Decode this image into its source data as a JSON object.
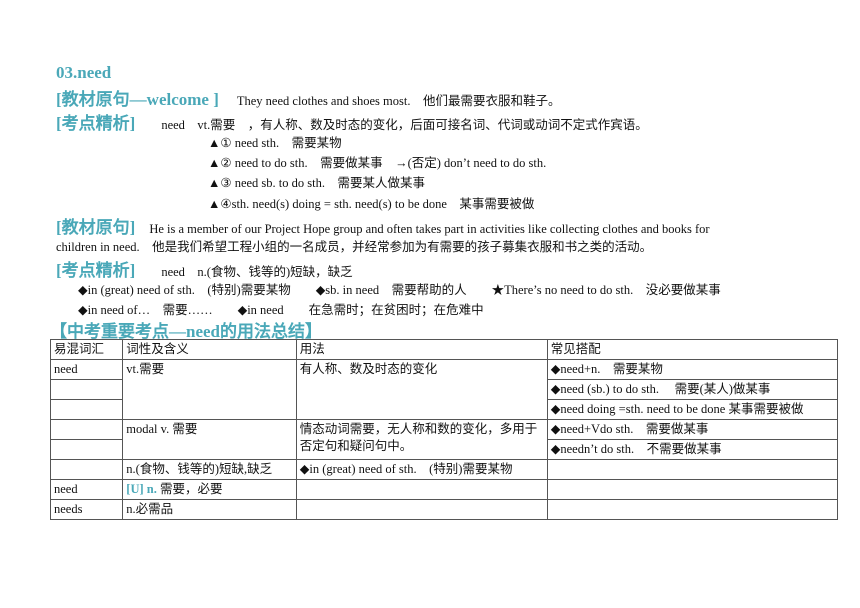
{
  "heading": "03.need",
  "sec1": {
    "tag": "[教材原句—welcome ]",
    "sentence": "They need clothes and shoes most.　他们最需要衣服和鞋子。"
  },
  "sec2": {
    "tag": "[考点精析]",
    "intro": "need　vt.需要　，有人称、数及时态的变化，后面可接名词、代词或动词不定式作宾语。",
    "items": [
      "▲① need sth.　需要某物",
      "▲② need to do sth.　需要做某事　→(否定) don’t need to do sth.",
      "▲③ need sb. to do sth.　需要某人做某事",
      "▲④sth. need(s) doing = sth. need(s) to be done　某事需要被做"
    ]
  },
  "sec3": {
    "tag": "[教材原句]",
    "line1": "He is a member of our Project Hope group and often takes part in activities like collecting clothes and books for",
    "line2": "children in need.　他是我们希望工程小组的一名成员，并经常参加为有需要的孩子募集衣服和书之类的活动。"
  },
  "sec4": {
    "tag": "[考点精析]",
    "intro": "need　n.(食物、钱等的)短缺，缺乏",
    "row1": "◆in (great) need of sth.　(特别)需要某物　　◆sb. in need　需要帮助的人　　★There’s no need to do sth.　没必要做某事",
    "row2": "◆in need of…　需要……　　◆in need　　在急需时；在贫困时；在危难中"
  },
  "summary_title": "【中考重要考点—need的用法总结】",
  "table": {
    "headers": [
      "易混词汇",
      "词性及含义",
      "用法",
      "常见搭配"
    ],
    "r1": {
      "word": "need",
      "pos": "vt.需要",
      "usage": "有人称、数及时态的变化",
      "c1": "◆need+n.　需要某物",
      "c2": "◆need (sb.) to do sth.　 需要(某人)做某事",
      "c3": "◆need doing =sth. need to be done  某事需要被做"
    },
    "r2": {
      "pos": "modal v.  需要",
      "usage": "情态动词需要，无人称和数的变化，多用于否定句和疑问句中。",
      "c1": "◆need+Vdo sth.　需要做某事",
      "c2": "◆needn’t do sth.　不需要做某事"
    },
    "r3": {
      "pos": "n.(食物、钱等的)短缺,缺乏",
      "usage": "◆in (great) need of sth.　(特别)需要某物"
    },
    "r4": {
      "word": "need",
      "pos_tag": "[U] n.",
      "pos": " 需要，必要"
    },
    "r5": {
      "word": "needs",
      "pos": "n.必需品"
    }
  }
}
